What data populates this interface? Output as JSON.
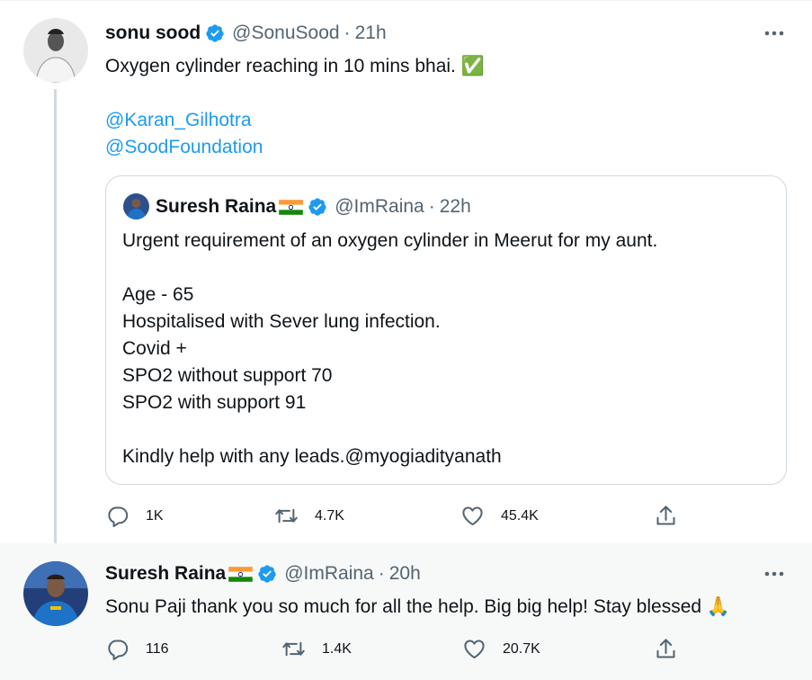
{
  "tweet1": {
    "name": "sonu sood",
    "handle": "@SonuSood",
    "separator": "·",
    "time": "21h",
    "text_line1": "Oxygen cylinder reaching in 10 mins bhai. ✅",
    "mention1": "@Karan_Gilhotra",
    "mention2": "@SoodFoundation",
    "quote": {
      "name": "Suresh Raina",
      "handle": "@ImRaina",
      "separator": "·",
      "time": "22h",
      "lines": [
        "Urgent requirement of an oxygen cylinder in Meerut for my aunt.",
        "Age - 65",
        "Hospitalised with Sever lung infection.",
        "Covid +",
        "SPO2 without support 70",
        "SPO2 with support 91",
        "Kindly help with any leads.@myogiadityanath"
      ]
    },
    "actions": {
      "replies": "1K",
      "retweets": "4.7K",
      "likes": "45.4K"
    }
  },
  "tweet2": {
    "name": "Suresh Raina",
    "handle": "@ImRaina",
    "separator": "·",
    "time": "20h",
    "text": "Sonu Paji thank you so much for all the help. Big big help! Stay blessed 🙏",
    "actions": {
      "replies": "116",
      "retweets": "1.4K",
      "likes": "20.7K"
    }
  },
  "colors": {
    "accent": "#1d9bf0",
    "secondary_text": "#536471",
    "border": "#cfd9de"
  },
  "icons": {
    "verified": "verified-badge-icon",
    "reply": "reply-icon",
    "retweet": "retweet-icon",
    "like": "heart-icon",
    "share": "share-icon",
    "more": "more-dots-icon",
    "flag": "india-flag-icon"
  }
}
